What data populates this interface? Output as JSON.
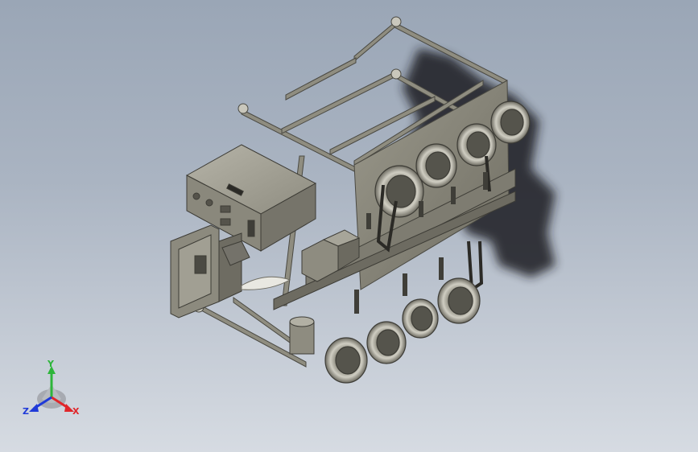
{
  "viewport": {
    "background_top": "#9aa6b6",
    "background_bottom": "#d6dbe2",
    "model_color": "#8b887b",
    "shadow_color": "#1d1f24"
  },
  "triad": {
    "x_label": "X",
    "y_label": "Y",
    "z_label": "Z",
    "x_color": "#e0262a",
    "y_color": "#2db53a",
    "z_color": "#1f3ad8"
  }
}
